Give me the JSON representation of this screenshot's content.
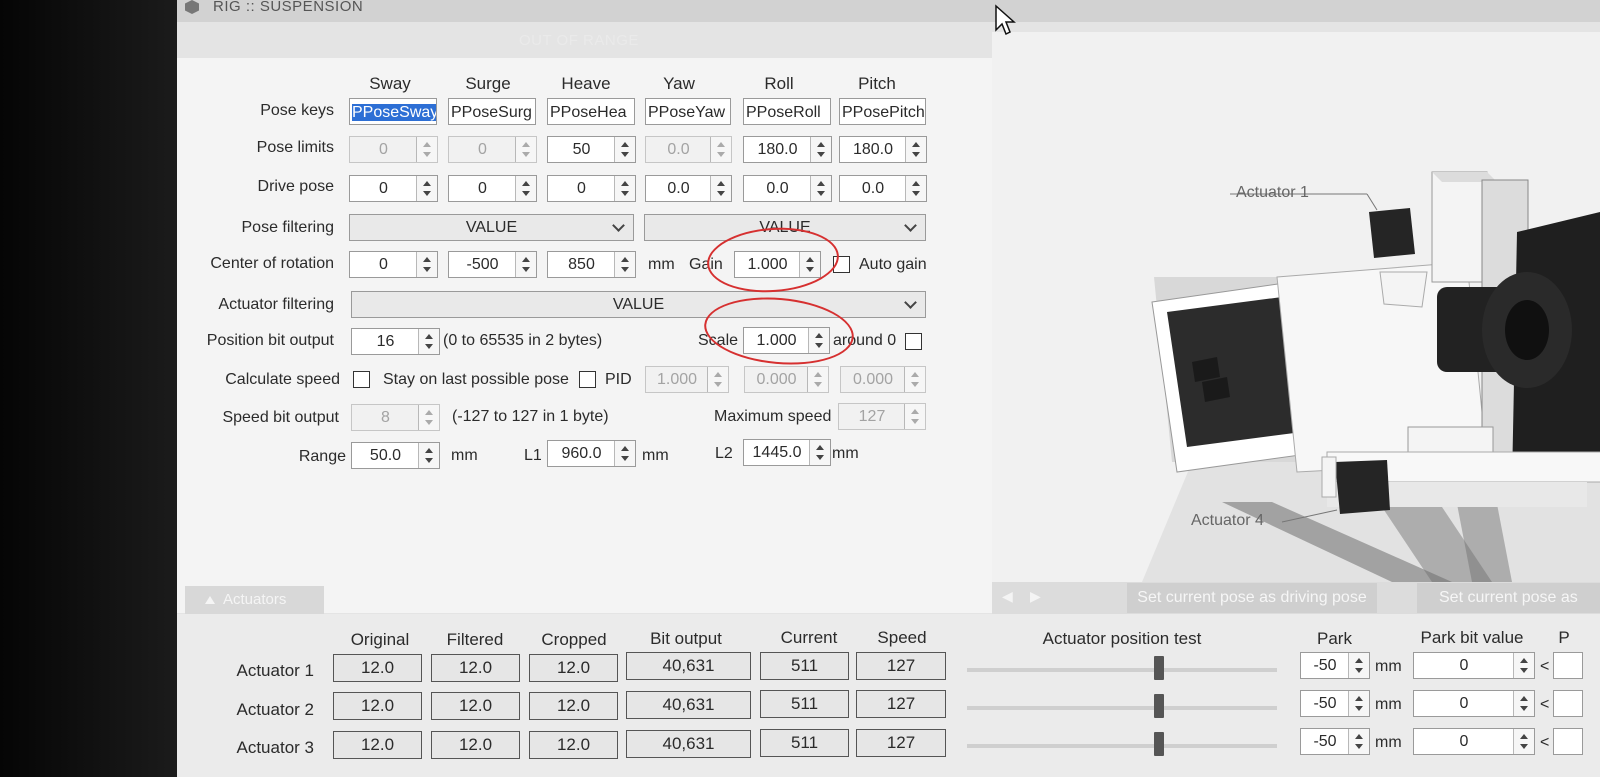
{
  "window": {
    "title": "RIG :: SUSPENSION",
    "status": "OUT OF RANGE"
  },
  "columns": [
    "Sway",
    "Surge",
    "Heave",
    "Yaw",
    "Roll",
    "Pitch"
  ],
  "pose_keys": {
    "label": "Pose keys",
    "values": [
      "PPoseSway",
      "PPoseSurge",
      "PPoseHeave",
      "PPoseYaw",
      "PPoseRoll",
      "PPosePitch"
    ],
    "display": [
      "PPoseSway",
      "PPoseSurg",
      "PPoseHea",
      "PPoseYaw",
      "PPoseRoll",
      "PPosePitch"
    ]
  },
  "pose_limits": {
    "label": "Pose limits",
    "values": [
      "0",
      "0",
      "50",
      "0.0",
      "180.0",
      "180.0"
    ]
  },
  "drive_pose": {
    "label": "Drive pose",
    "values": [
      "0",
      "0",
      "0",
      "0.0",
      "0.0",
      "0.0"
    ]
  },
  "pose_filtering": {
    "label": "Pose filtering",
    "left": "VALUE",
    "right": "VALUE"
  },
  "center_of_rotation": {
    "label": "Center of rotation",
    "values": [
      "0",
      "-500",
      "850"
    ],
    "unit": "mm",
    "gain_label": "Gain",
    "gain": "1.000",
    "auto_gain_label": "Auto gain"
  },
  "actuator_filtering": {
    "label": "Actuator filtering",
    "value": "VALUE"
  },
  "position_bit_output": {
    "label": "Position bit output",
    "value": "16",
    "note": "(0 to 65535 in 2 bytes)",
    "scale_label": "Scale",
    "scale": "1.000",
    "around_label": "around 0"
  },
  "calculate_speed": {
    "label": "Calculate speed",
    "stay_label": "Stay on last possible pose",
    "pid_label": "PID",
    "pid": [
      "1.000",
      "0.000",
      "0.000"
    ]
  },
  "speed_bit_output": {
    "label": "Speed bit output",
    "value": "8",
    "note": "(-127 to 127 in 1 byte)",
    "max_speed_label": "Maximum speed",
    "max_speed": "127"
  },
  "range": {
    "label": "Range",
    "value": "50.0",
    "unit": "mm",
    "l1_label": "L1",
    "l1": "960.0",
    "l1_unit": "mm",
    "l2_label": "L2",
    "l2": "1445.0",
    "l2_unit": "mm"
  },
  "rig_view": {
    "actuator1_label": "Actuator 1",
    "actuator4_label": "Actuator 4"
  },
  "view_nav": {
    "prev": "◀",
    "next": "▶",
    "set_driving": "Set current pose as driving pose",
    "set_other": "Set current pose as"
  },
  "actuators_tab": {
    "label": "Actuators",
    "icon": "triangle-up-icon"
  },
  "actuators_table": {
    "headers": [
      "Original",
      "Filtered",
      "Cropped",
      "Bit output",
      "Current",
      "Speed"
    ],
    "position_test_label": "Actuator position test",
    "park_label": "Park",
    "park_bit_label": "Park bit value",
    "extra_header": "P",
    "rows": [
      {
        "name": "Actuator 1",
        "original": "12.0",
        "filtered": "12.0",
        "cropped": "12.0",
        "bit_output": "40,631",
        "current": "511",
        "speed": "127",
        "park": "-50",
        "park_unit": "mm",
        "park_bit": "0",
        "lt": "<"
      },
      {
        "name": "Actuator 2",
        "original": "12.0",
        "filtered": "12.0",
        "cropped": "12.0",
        "bit_output": "40,631",
        "current": "511",
        "speed": "127",
        "park": "-50",
        "park_unit": "mm",
        "park_bit": "0",
        "lt": "<"
      },
      {
        "name": "Actuator 3",
        "original": "12.0",
        "filtered": "12.0",
        "cropped": "12.0",
        "bit_output": "40,631",
        "current": "511",
        "speed": "127",
        "park": "-50",
        "park_unit": "mm",
        "park_bit": "0",
        "lt": "<"
      }
    ]
  },
  "colors": {
    "annotation": "#d63030",
    "selection": "#2d6fd5"
  }
}
